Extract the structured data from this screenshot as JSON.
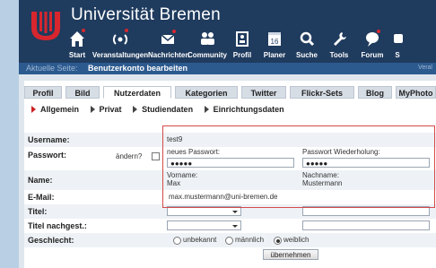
{
  "header": {
    "site_title": "Universität Bremen"
  },
  "nav": [
    {
      "label": "Start",
      "icon": "home-icon"
    },
    {
      "label": "Veranstaltungen",
      "icon": "broadcast-icon"
    },
    {
      "label": "Nachrichten",
      "icon": "mail-icon"
    },
    {
      "label": "Community",
      "icon": "people-icon"
    },
    {
      "label": "Profil",
      "icon": "profile-card-icon"
    },
    {
      "label": "Planer",
      "icon": "calendar-icon"
    },
    {
      "label": "Suche",
      "icon": "search-icon"
    },
    {
      "label": "Tools",
      "icon": "wrench-icon"
    },
    {
      "label": "Forum",
      "icon": "chat-icon"
    },
    {
      "label": "S",
      "icon": "more-icon"
    }
  ],
  "subbar": {
    "label": "Aktuelle Seite:",
    "value": "Benutzerkonto bearbeiten",
    "right": "Veral"
  },
  "tabs": [
    "Profil",
    "Bild",
    "Nutzerdaten",
    "Kategorien",
    "Twitter",
    "Flickr-Sets",
    "Blog",
    "MyPhoto"
  ],
  "subtabs": [
    "Allgemein",
    "Privat",
    "Studiendaten",
    "Einrichtungsdaten"
  ],
  "form": {
    "username_label": "Username:",
    "username_value": "test9",
    "password_label": "Passwort:",
    "change_label": "ändern?",
    "new_password_label": "neues Passwort:",
    "new_password_value": "●●●●●",
    "repeat_password_label": "Passwort Wiederholung:",
    "repeat_password_value": "●●●●●",
    "name_label": "Name:",
    "firstname_label": "Vorname:",
    "firstname_value": "Max",
    "lastname_label": "Nachname:",
    "lastname_value": "Mustermann",
    "email_label": "E-Mail:",
    "email_value": "max.mustermann@uni-bremen.de",
    "title_label": "Titel:",
    "title_after_label": "Titel nachgest.:",
    "gender_label": "Geschlecht:",
    "gender_options": [
      "unbekannt",
      "männlich",
      "weiblich"
    ],
    "submit_label": "übernehmen"
  },
  "colors": {
    "header": "#1f3b5e",
    "subbar": "#2c5a8f",
    "accent_red": "#cc2222"
  }
}
